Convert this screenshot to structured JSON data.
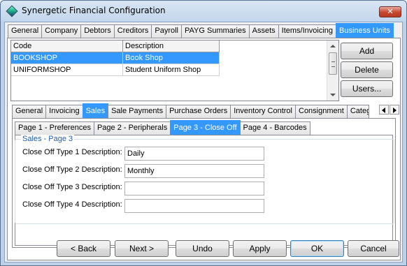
{
  "window": {
    "title": "Synergetic Financial Configuration",
    "close_glyph": "✕"
  },
  "top_tabs": [
    "General",
    "Company",
    "Debtors",
    "Creditors",
    "Payroll",
    "PAYG Summaries",
    "Assets",
    "Items/Invoicing",
    "Business Units"
  ],
  "top_tab_selected": 8,
  "grid": {
    "columns": [
      "Code",
      "Description"
    ],
    "rows": [
      {
        "code": "BOOKSHOP",
        "description": "Book Shop",
        "selected": true
      },
      {
        "code": "UNIFORMSHOP",
        "description": "Student Uniform Shop",
        "selected": false
      }
    ]
  },
  "side_buttons": {
    "add": "Add",
    "delete": "Delete",
    "users": "Users..."
  },
  "mid_tabs": [
    "General",
    "Invoicing",
    "Sales",
    "Sale Payments",
    "Purchase Orders",
    "Inventory Control",
    "Consignment",
    "Categ"
  ],
  "mid_tab_selected": 2,
  "page_tabs": [
    "Page 1 - Preferences",
    "Page 2 - Peripherals",
    "Page 3 - Close Off",
    "Page 4 - Barcodes"
  ],
  "page_tab_selected": 2,
  "group": {
    "legend": "Sales - Page 3",
    "fields": [
      {
        "label": "Close Off Type 1 Description:",
        "value": "Daily"
      },
      {
        "label": "Close Off Type 2 Description:",
        "value": "Monthly"
      },
      {
        "label": "Close Off Type 3 Description:",
        "value": ""
      },
      {
        "label": "Close Off Type 4 Description:",
        "value": ""
      }
    ]
  },
  "footer_buttons": {
    "back": "< Back",
    "next": "Next >",
    "undo": "Undo",
    "apply": "Apply",
    "ok": "OK",
    "cancel": "Cancel"
  },
  "colors": {
    "selection": "#3399ff",
    "title_bar": "#c2d6ec",
    "close_button": "#c7472e"
  }
}
